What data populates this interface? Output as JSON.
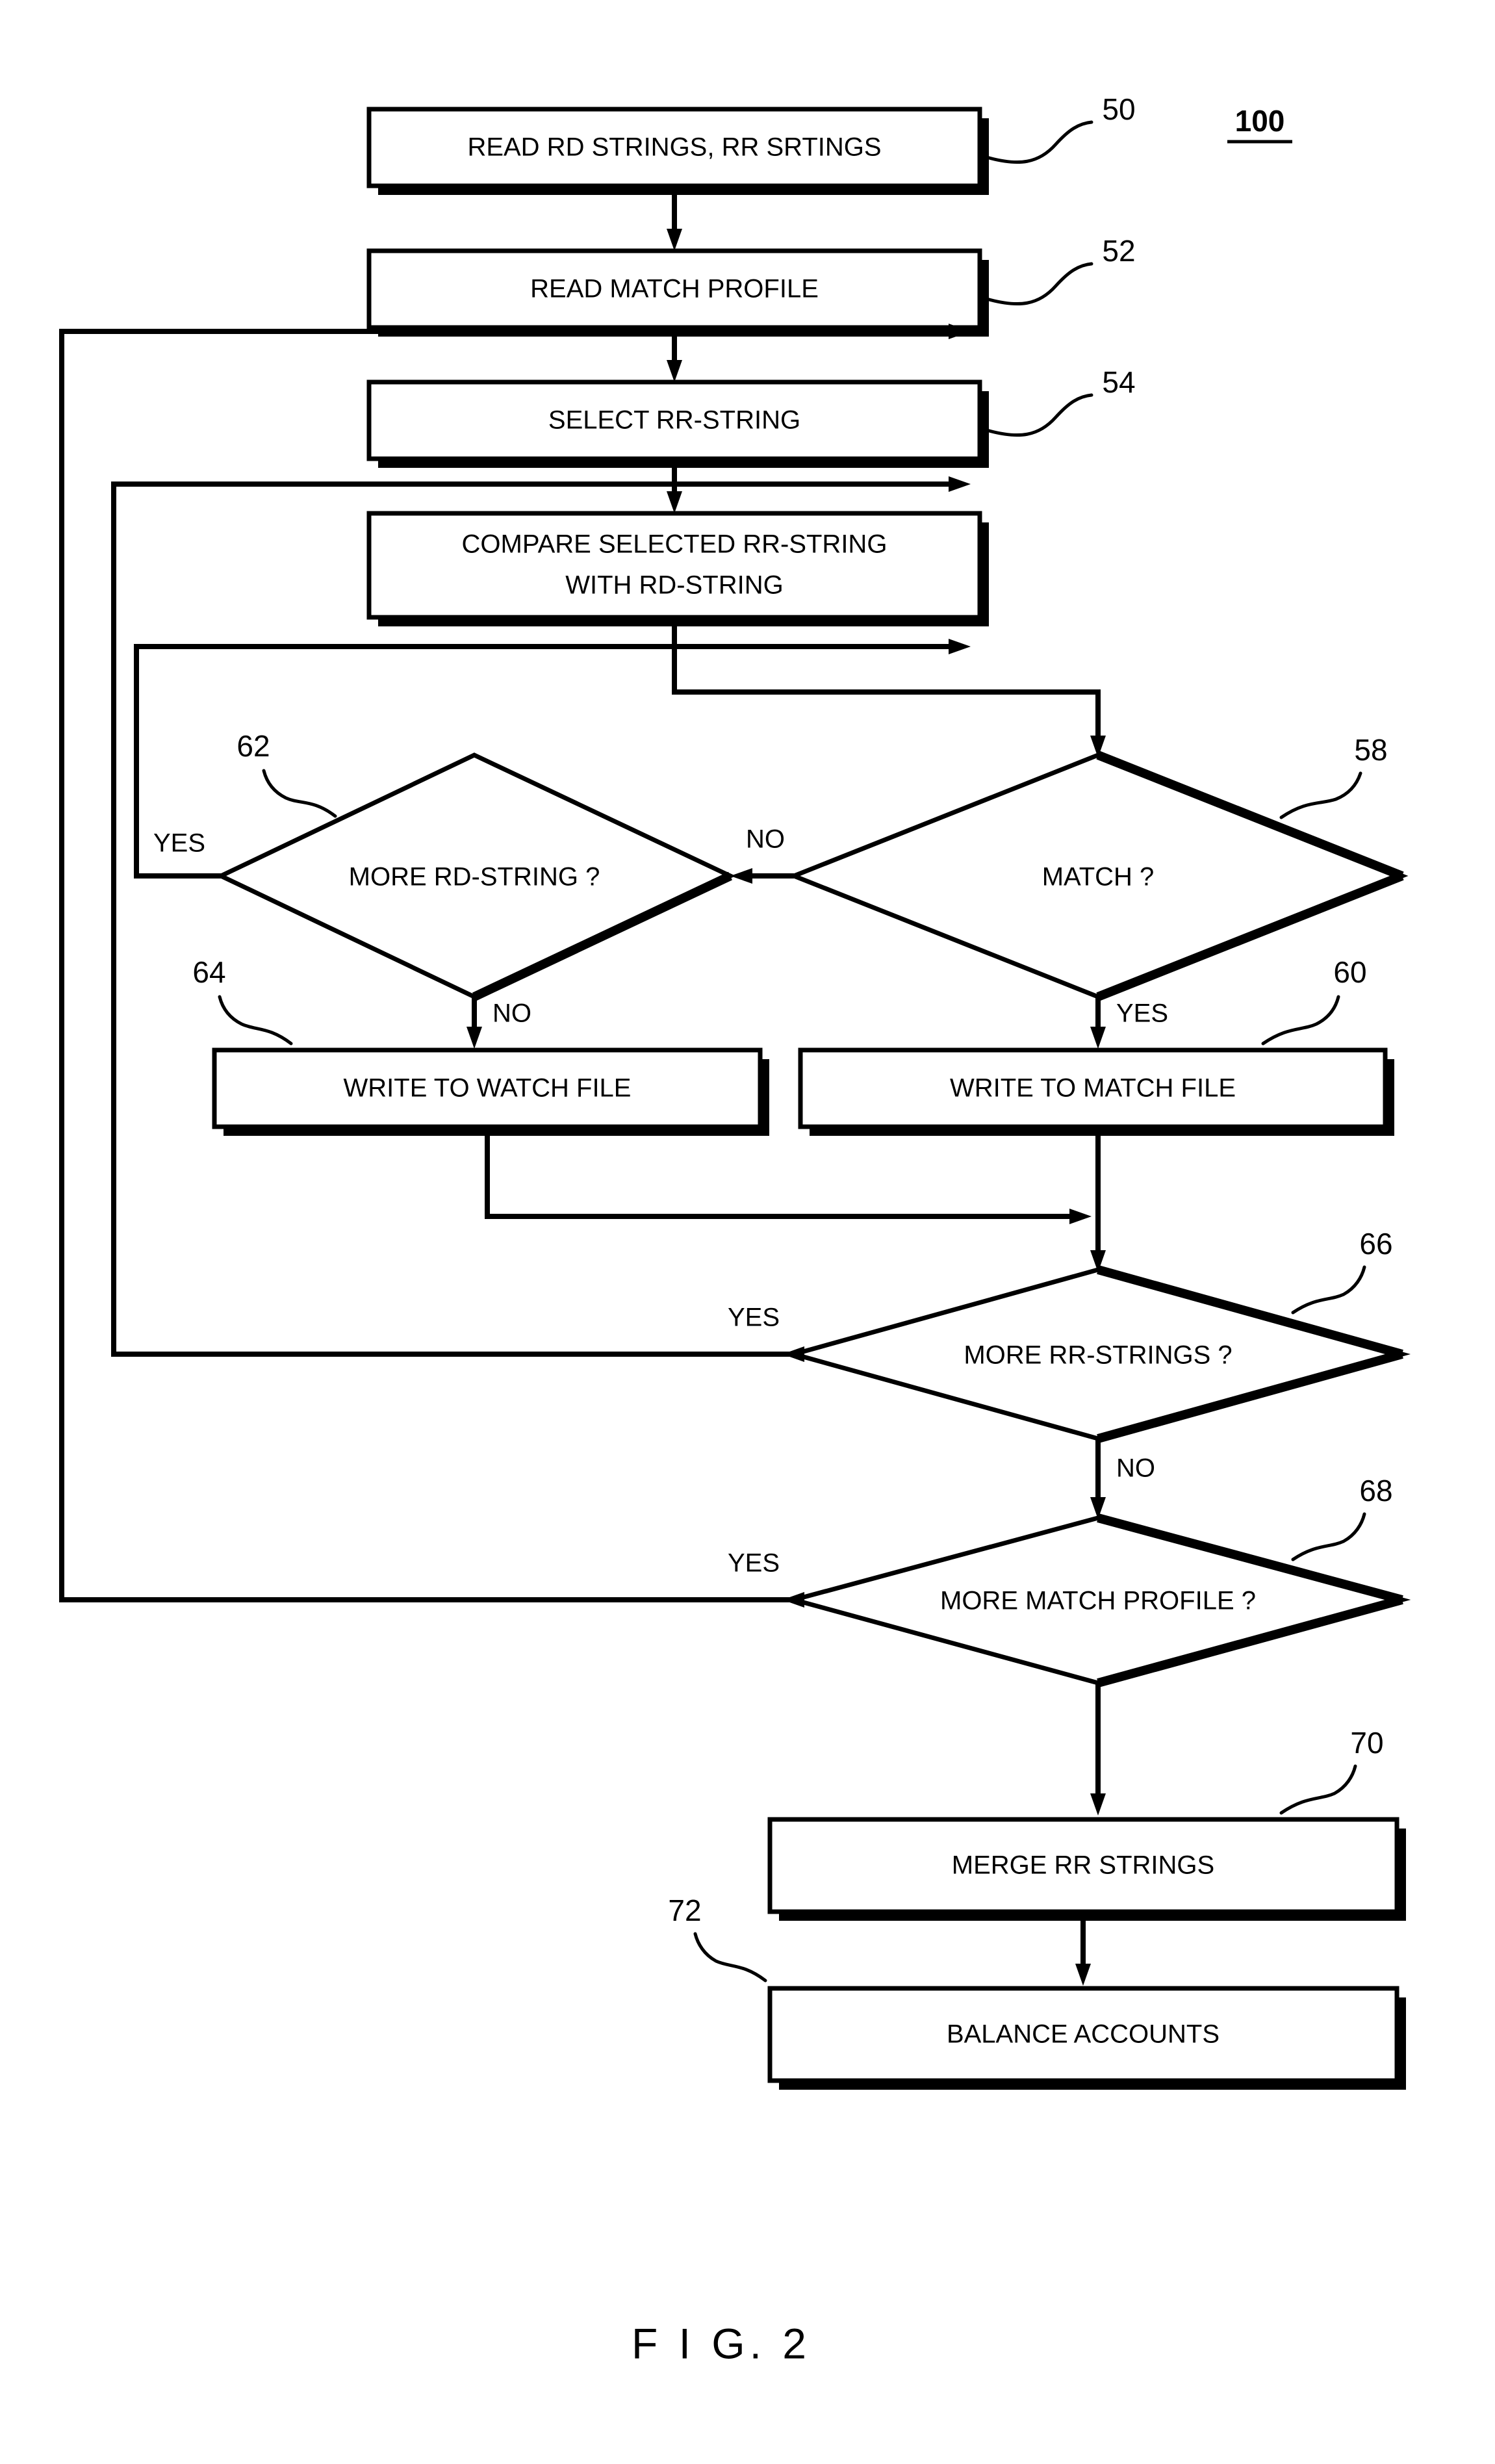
{
  "figure": {
    "caption": "F I G. 2",
    "system_number": "100"
  },
  "process_boxes": [
    {
      "id": "50",
      "ref": "50",
      "label": "READ RD STRINGS, RR SRTINGS"
    },
    {
      "id": "52",
      "ref": "52",
      "label": "READ MATCH PROFILE"
    },
    {
      "id": "54",
      "ref": "54",
      "label": "SELECT RR-STRING"
    },
    {
      "id": "56",
      "ref": "",
      "label_line1": "COMPARE SELECTED RR-STRING",
      "label_line2": "WITH RD-STRING"
    },
    {
      "id": "64",
      "ref": "64",
      "label": "WRITE TO WATCH FILE"
    },
    {
      "id": "60",
      "ref": "60",
      "label": "WRITE TO MATCH FILE"
    },
    {
      "id": "70",
      "ref": "70",
      "label": "MERGE RR STRINGS"
    },
    {
      "id": "72",
      "ref": "72",
      "label": "BALANCE ACCOUNTS"
    }
  ],
  "decisions": [
    {
      "id": "58",
      "ref": "58",
      "label": "MATCH ?",
      "yes_branch": "YES",
      "no_branch": "NO"
    },
    {
      "id": "62",
      "ref": "62",
      "label": "MORE RD-STRING ?",
      "yes_branch": "YES",
      "no_branch": "NO"
    },
    {
      "id": "66",
      "ref": "66",
      "label": "MORE RR-STRINGS ?",
      "yes_branch": "YES",
      "no_branch": "NO"
    },
    {
      "id": "68",
      "ref": "68",
      "label": "MORE MATCH PROFILE ?",
      "yes_branch": "YES",
      "no_branch": "NO"
    }
  ],
  "edge_labels": {
    "match_no": "NO",
    "match_yes": "YES",
    "more_rd_yes": "YES",
    "more_rd_no": "NO",
    "more_rr_yes": "YES",
    "more_rr_no": "NO",
    "more_profile_yes": "YES"
  },
  "colors": {
    "ink": "#000000",
    "paper": "#ffffff"
  }
}
